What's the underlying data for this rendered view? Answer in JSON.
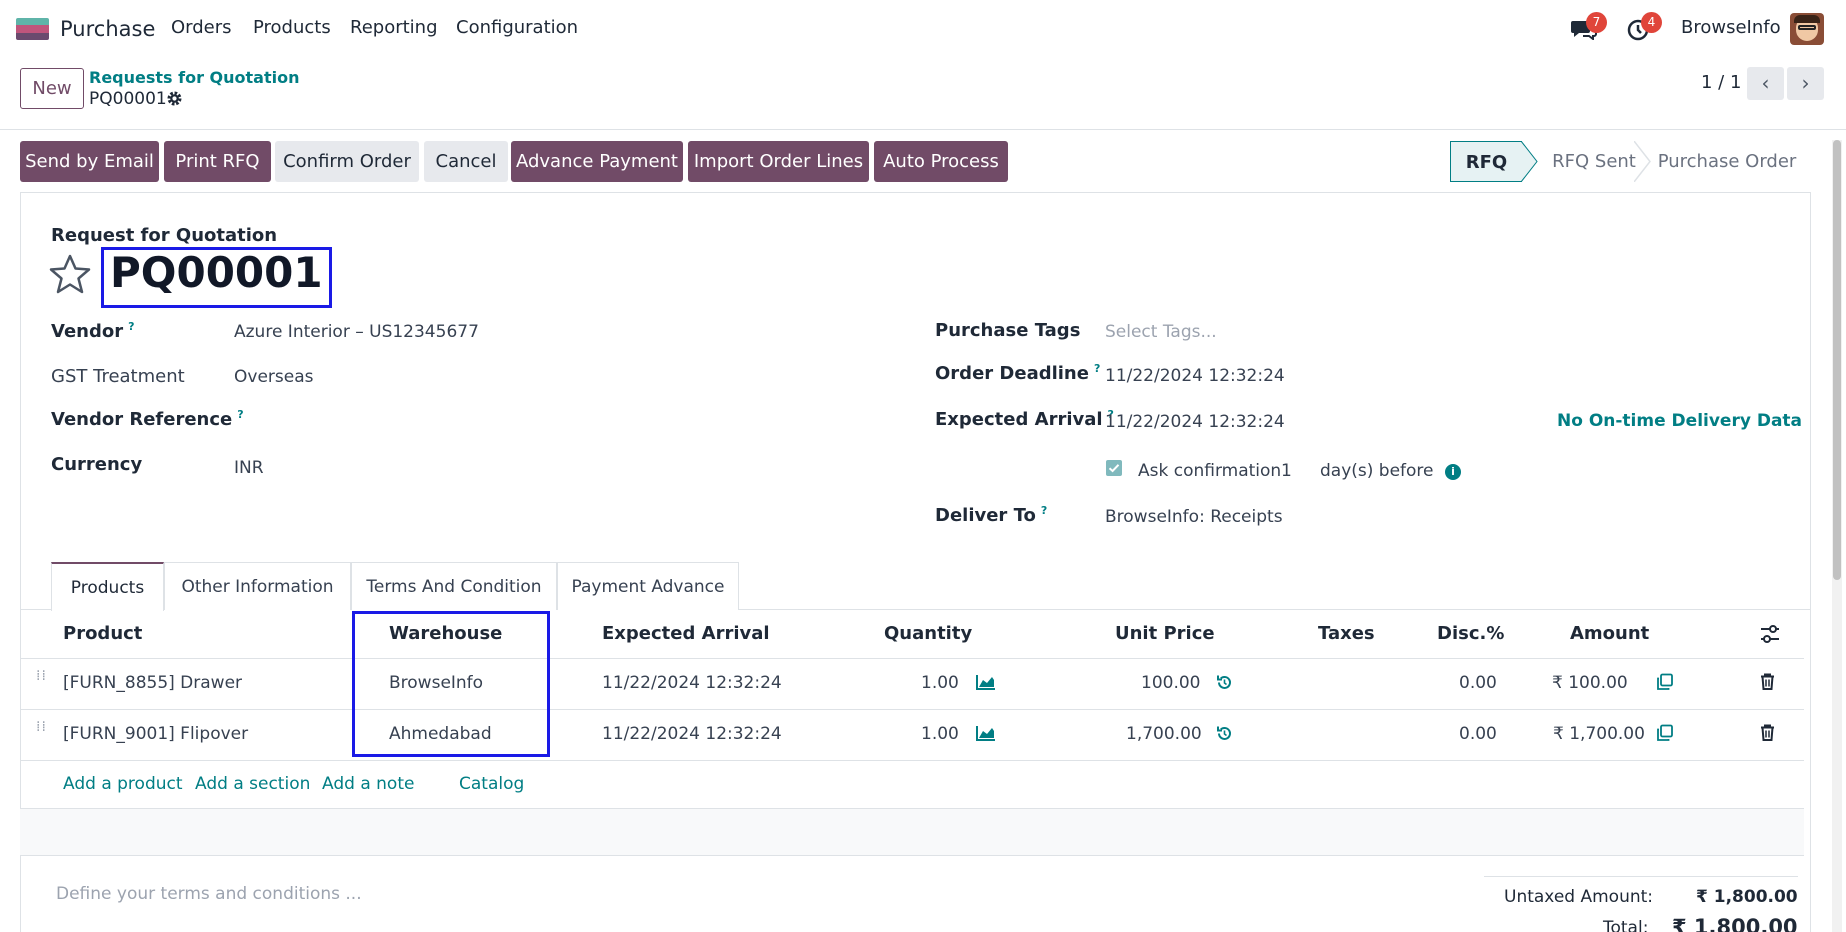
{
  "topbar": {
    "app_name": "Purchase",
    "menu": [
      "Orders",
      "Products",
      "Reporting",
      "Configuration"
    ],
    "messages_count": "7",
    "activities_count": "4",
    "company": "BrowseInfo"
  },
  "control": {
    "new_label": "New",
    "breadcrumb_parent": "Requests for Quotation",
    "breadcrumb_current": "PQ00001",
    "pager": "1 / 1"
  },
  "actions": {
    "send_email": "Send by Email",
    "print_rfq": "Print RFQ",
    "confirm": "Confirm Order",
    "cancel": "Cancel",
    "advance_payment": "Advance Payment",
    "import_lines": "Import Order Lines",
    "auto_process": "Auto Process"
  },
  "status": {
    "stages": [
      "RFQ",
      "RFQ Sent",
      "Purchase Order"
    ],
    "active": "RFQ"
  },
  "form": {
    "doc_type": "Request for Quotation",
    "name": "PQ00001",
    "vendor_label": "Vendor",
    "vendor": "Azure Interior – US12345677",
    "gst_label": "GST Treatment",
    "gst": "Overseas",
    "vendor_ref_label": "Vendor Reference",
    "currency_label": "Currency",
    "currency": "INR",
    "tags_label": "Purchase Tags",
    "tags_placeholder": "Select Tags...",
    "deadline_label": "Order Deadline",
    "deadline": "11/22/2024 12:32:24",
    "arrival_label": "Expected Arrival",
    "arrival": "11/22/2024 12:32:24",
    "ontime": "No On-time Delivery Data",
    "ask_confirm": "Ask confirmation",
    "ask_days": "1",
    "days_before": "day(s) before",
    "deliver_label": "Deliver To",
    "deliver": "BrowseInfo: Receipts"
  },
  "tabs": [
    "Products",
    "Other Information",
    "Terms And Condition",
    "Payment Advance"
  ],
  "table": {
    "headers": [
      "Product",
      "Warehouse",
      "Expected Arrival",
      "Quantity",
      "Unit Price",
      "Taxes",
      "Disc.%",
      "Amount"
    ],
    "rows": [
      {
        "product": "[FURN_8855] Drawer",
        "warehouse": "BrowseInfo",
        "arrival": "11/22/2024 12:32:24",
        "qty": "1.00",
        "price": "100.00",
        "disc": "0.00",
        "amount": "₹ 100.00"
      },
      {
        "product": "[FURN_9001] Flipover",
        "warehouse": "Ahmedabad",
        "arrival": "11/22/2024 12:32:24",
        "qty": "1.00",
        "price": "1,700.00",
        "disc": "0.00",
        "amount": "₹ 1,700.00"
      }
    ],
    "add_product": "Add a product",
    "add_section": "Add a section",
    "add_note": "Add a note",
    "catalog": "Catalog"
  },
  "footer": {
    "terms_placeholder": "Define your terms and conditions ...",
    "untaxed_label": "Untaxed Amount:",
    "untaxed": "₹ 1,800.00",
    "total_label": "Total:",
    "total": "₹ 1,800.00"
  },
  "colors": {
    "brand": "#714b67",
    "accent": "#017e84",
    "highlight": "#1a1ae6",
    "badge": "#e0453a"
  }
}
